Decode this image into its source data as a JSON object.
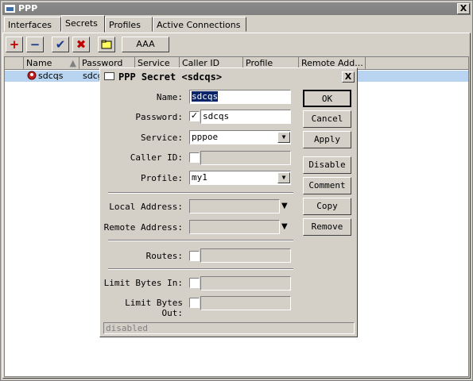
{
  "window": {
    "title": "PPP",
    "close_glyph": "X"
  },
  "tabs": [
    "Interfaces",
    "Secrets",
    "Profiles",
    "Active Connections"
  ],
  "active_tab": "Secrets",
  "toolbar": {
    "add_icon": "plus-icon",
    "remove_icon": "minus-icon",
    "enable_icon": "check-icon",
    "disable_icon": "x-icon",
    "comment_icon": "note-icon",
    "aaa_label": "AAA"
  },
  "table": {
    "columns": [
      "Name",
      "Password",
      "Service",
      "Caller ID",
      "Profile",
      "Remote Add..."
    ],
    "rows": [
      {
        "name": "sdcqs",
        "password": "sdcg"
      }
    ]
  },
  "dialog": {
    "title": "PPP Secret <sdcqs>",
    "close_glyph": "X",
    "labels": {
      "name": "Name:",
      "password": "Password:",
      "service": "Service:",
      "caller_id": "Caller ID:",
      "profile": "Profile:",
      "local_address": "Local Address:",
      "remote_address": "Remote Address:",
      "routes": "Routes:",
      "limit_in": "Limit Bytes In:",
      "limit_out": "Limit Bytes Out:"
    },
    "values": {
      "name": "sdcqs",
      "password": "sdcqs",
      "service": "pppoe",
      "profile": "my1"
    },
    "buttons": [
      "OK",
      "Cancel",
      "Apply",
      "Disable",
      "Comment",
      "Copy",
      "Remove"
    ],
    "status": "disabled"
  },
  "colors": {
    "selection": "#b8d4f0",
    "title_active": "#0a246a"
  }
}
